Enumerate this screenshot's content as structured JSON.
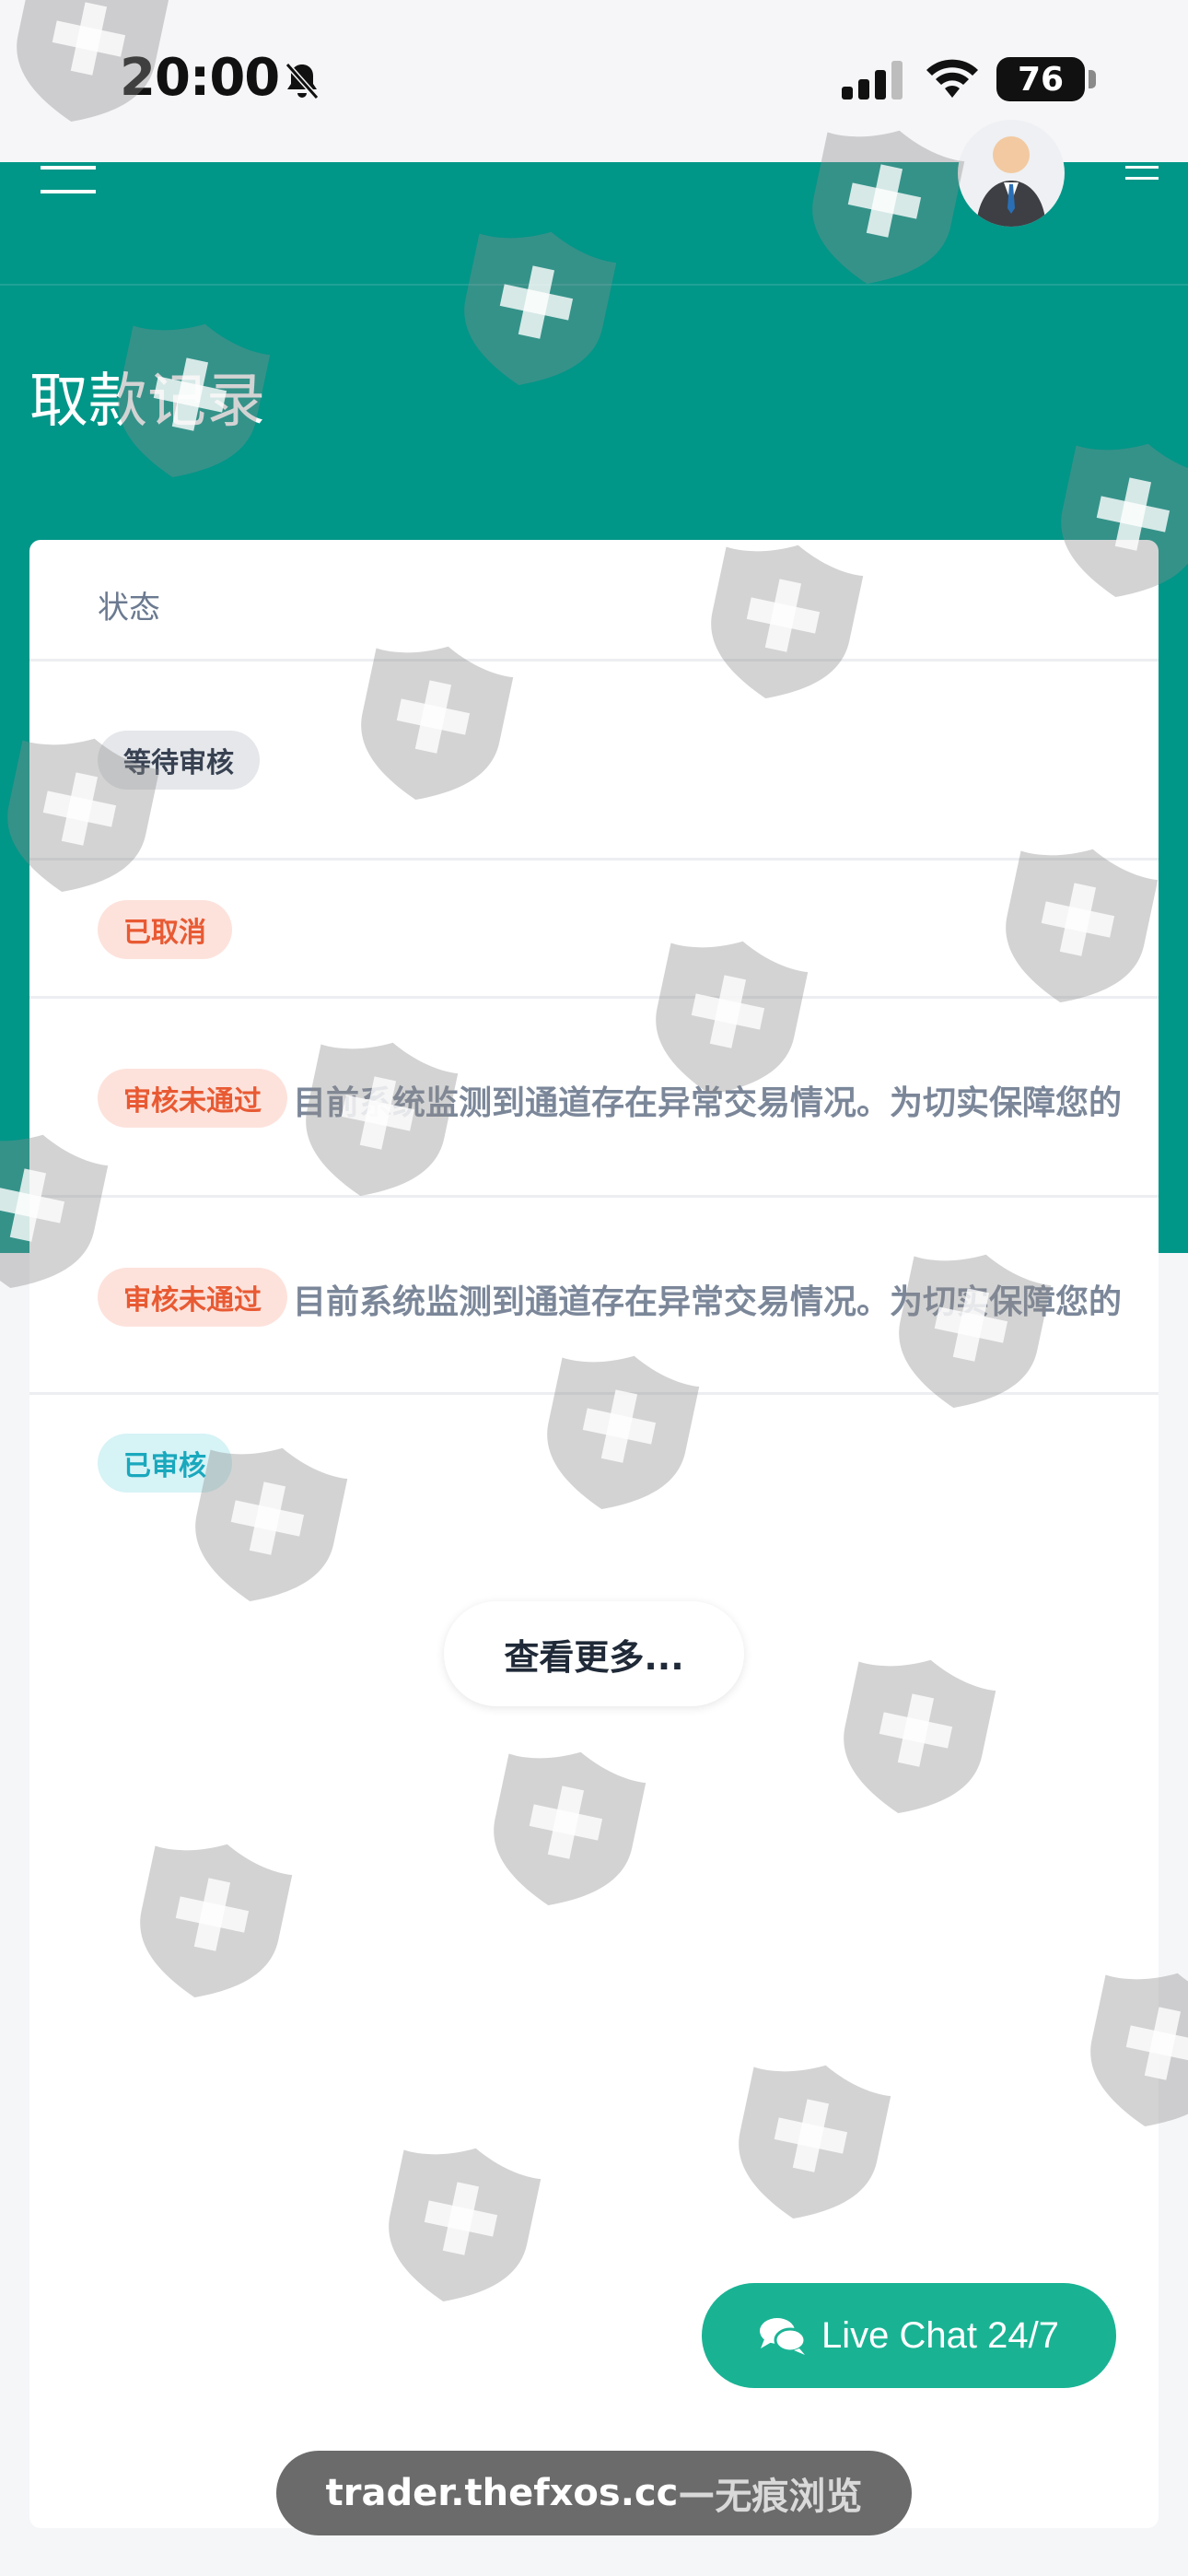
{
  "status_bar": {
    "time": "20:00",
    "battery": "76"
  },
  "icons": {
    "menu": "hamburger-menu-icon",
    "bell": "bell-slash-icon",
    "chat": "chat-bubbles-icon",
    "watermark": "shield-plus-icon"
  },
  "page": {
    "title": "取款记录"
  },
  "table": {
    "column_status": "状态",
    "rows": [
      {
        "status": "等待审核",
        "remark": ""
      },
      {
        "status": "已取消",
        "remark": ""
      },
      {
        "status": "审核未通过",
        "remark": "目前系统监测到通道存在异常交易情况。为切实保障您的"
      },
      {
        "status": "审核未通过",
        "remark": "目前系统监测到通道存在异常交易情况。为切实保障您的"
      },
      {
        "status": "已审核",
        "remark": ""
      }
    ]
  },
  "more_button": "查看更多...",
  "live_chat": "Live Chat 24/7",
  "browser": {
    "url": "trader.thefxos.cc",
    "separator": " — ",
    "mode": "无痕浏览"
  },
  "colors": {
    "header": "#009688",
    "chat_button": "#19b394",
    "badge_pending": "#e5e7ea",
    "badge_rejected": "#fde2dc",
    "badge_approved": "#d6f3f6"
  }
}
